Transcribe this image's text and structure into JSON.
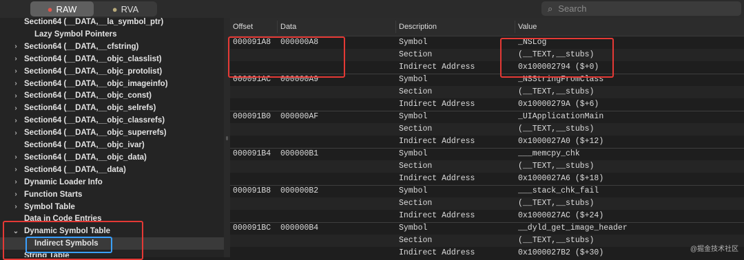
{
  "toolbar": {
    "tabs": [
      {
        "label": "RAW",
        "icon": "apple-icon",
        "active": true
      },
      {
        "label": "RVA",
        "icon": "apple-icon",
        "active": false
      }
    ],
    "search_placeholder": "Search"
  },
  "sidebar": {
    "items": [
      {
        "label": "Section64 (__DATA,__la_symbol_ptr)",
        "expandable": false,
        "indent": 1
      },
      {
        "label": "Lazy Symbol Pointers",
        "expandable": false,
        "indent": 2
      },
      {
        "label": "Section64 (__DATA,__cfstring)",
        "expandable": true,
        "indent": 1
      },
      {
        "label": "Section64 (__DATA,__objc_classlist)",
        "expandable": true,
        "indent": 1
      },
      {
        "label": "Section64 (__DATA,__objc_protolist)",
        "expandable": true,
        "indent": 1
      },
      {
        "label": "Section64 (__DATA,__objc_imageinfo)",
        "expandable": true,
        "indent": 1
      },
      {
        "label": "Section64 (__DATA,__objc_const)",
        "expandable": true,
        "indent": 1
      },
      {
        "label": "Section64 (__DATA,__objc_selrefs)",
        "expandable": true,
        "indent": 1
      },
      {
        "label": "Section64 (__DATA,__objc_classrefs)",
        "expandable": true,
        "indent": 1
      },
      {
        "label": "Section64 (__DATA,__objc_superrefs)",
        "expandable": true,
        "indent": 1
      },
      {
        "label": "Section64 (__DATA,__objc_ivar)",
        "expandable": false,
        "indent": 1
      },
      {
        "label": "Section64 (__DATA,__objc_data)",
        "expandable": true,
        "indent": 1
      },
      {
        "label": "Section64 (__DATA,__data)",
        "expandable": true,
        "indent": 1
      },
      {
        "label": "Dynamic Loader Info",
        "expandable": true,
        "indent": 1
      },
      {
        "label": "Function Starts",
        "expandable": true,
        "indent": 1
      },
      {
        "label": "Symbol Table",
        "expandable": true,
        "indent": 1
      },
      {
        "label": "Data in Code Entries",
        "expandable": false,
        "indent": 1
      },
      {
        "label": "Dynamic Symbol Table",
        "expandable": true,
        "expanded": true,
        "indent": 1
      },
      {
        "label": "Indirect Symbols",
        "expandable": false,
        "indent": 2,
        "selected": true
      },
      {
        "label": "String Table",
        "expandable": false,
        "indent": 1
      }
    ]
  },
  "table": {
    "columns": [
      "Offset",
      "Data",
      "Description",
      "Value"
    ],
    "groups": [
      {
        "offset": "000091A8",
        "data": "000000A8",
        "rows": [
          {
            "description": "Symbol",
            "value": "_NSLog"
          },
          {
            "description": "Section",
            "value": "(__TEXT,__stubs)"
          },
          {
            "description": "Indirect Address",
            "value": "0x100002794 ($+0)"
          }
        ]
      },
      {
        "offset": "000091AC",
        "data": "000000A9",
        "rows": [
          {
            "description": "Symbol",
            "value": "_NSStringFromClass"
          },
          {
            "description": "Section",
            "value": "(__TEXT,__stubs)"
          },
          {
            "description": "Indirect Address",
            "value": "0x10000279A ($+6)"
          }
        ]
      },
      {
        "offset": "000091B0",
        "data": "000000AF",
        "rows": [
          {
            "description": "Symbol",
            "value": "_UIApplicationMain"
          },
          {
            "description": "Section",
            "value": "(__TEXT,__stubs)"
          },
          {
            "description": "Indirect Address",
            "value": "0x1000027A0 ($+12)"
          }
        ]
      },
      {
        "offset": "000091B4",
        "data": "000000B1",
        "rows": [
          {
            "description": "Symbol",
            "value": "___memcpy_chk"
          },
          {
            "description": "Section",
            "value": "(__TEXT,__stubs)"
          },
          {
            "description": "Indirect Address",
            "value": "0x1000027A6 ($+18)"
          }
        ]
      },
      {
        "offset": "000091B8",
        "data": "000000B2",
        "rows": [
          {
            "description": "Symbol",
            "value": "___stack_chk_fail"
          },
          {
            "description": "Section",
            "value": "(__TEXT,__stubs)"
          },
          {
            "description": "Indirect Address",
            "value": "0x1000027AC ($+24)"
          }
        ]
      },
      {
        "offset": "000091BC",
        "data": "000000B4",
        "rows": [
          {
            "description": "Symbol",
            "value": "__dyld_get_image_header"
          },
          {
            "description": "Section",
            "value": "(__TEXT,__stubs)"
          },
          {
            "description": "Indirect Address",
            "value": "0x1000027B2 ($+30)"
          }
        ]
      }
    ]
  },
  "watermark": "@掘金技术社区",
  "colors": {
    "annotation_red": "#e53935",
    "annotation_blue": "#3aa0ff"
  }
}
